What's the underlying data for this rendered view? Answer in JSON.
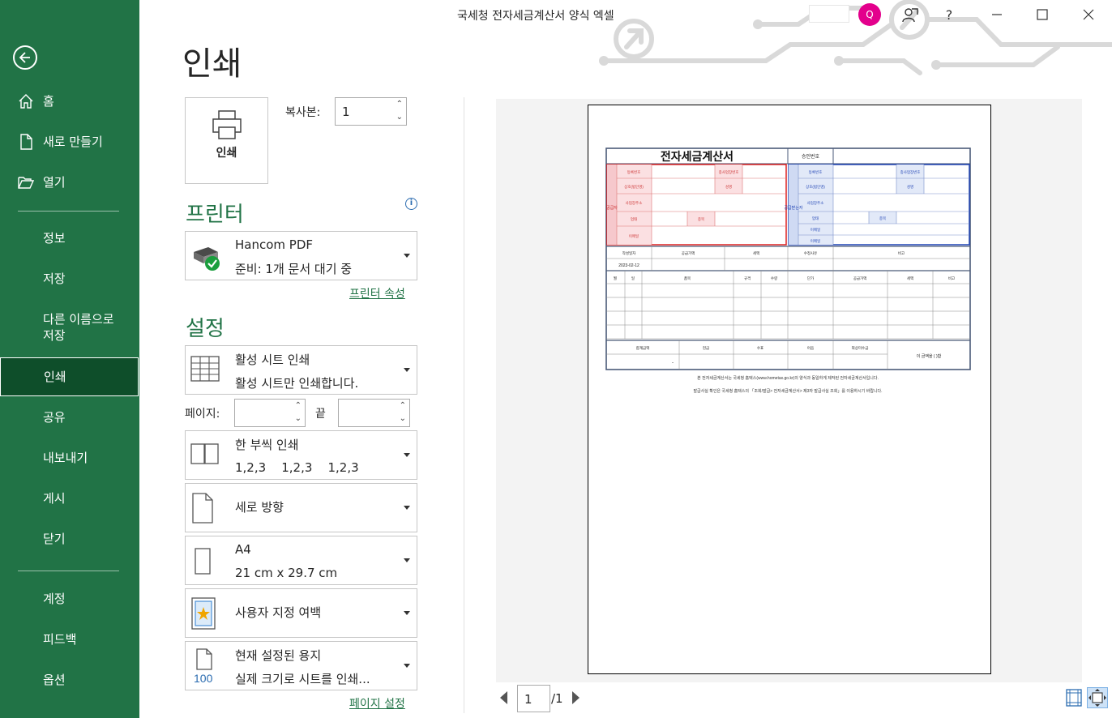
{
  "window": {
    "title": "국세청 전자세금계산서 양식 엑셀",
    "avatar_initial": "Q",
    "help_label": "?"
  },
  "sidebar": {
    "items": [
      {
        "label": "홈",
        "icon": "home-icon"
      },
      {
        "label": "새로 만들기",
        "icon": "new-document-icon"
      },
      {
        "label": "열기",
        "icon": "open-folder-icon"
      },
      {
        "label": "정보"
      },
      {
        "label": "저장"
      },
      {
        "label": "다른 이름으로\n저장"
      },
      {
        "label": "인쇄",
        "active": true
      },
      {
        "label": "공유"
      },
      {
        "label": "내보내기"
      },
      {
        "label": "게시"
      },
      {
        "label": "닫기"
      },
      {
        "label": "계정"
      },
      {
        "label": "피드백"
      },
      {
        "label": "옵션"
      }
    ]
  },
  "main": {
    "title": "인쇄",
    "print_button_label": "인쇄",
    "copies_label": "복사본:",
    "copies_value": "1",
    "printer_section_title": "프린터",
    "printer_name": "Hancom PDF",
    "printer_status": "준비: 1개 문서 대기 중",
    "printer_properties_link": "프린터 속성",
    "settings_section_title": "설정",
    "settings": {
      "what": {
        "line1": "활성 시트 인쇄",
        "line2": "활성 시트만 인쇄합니다."
      },
      "pages_label": "페이지:",
      "pages_to_label": "끝",
      "collate": {
        "line1": "한 부씩 인쇄",
        "line2": "1,2,3    1,2,3    1,2,3"
      },
      "orientation": {
        "line1": "세로 방향"
      },
      "paper": {
        "line1": "A4",
        "line2": "21 cm x 29.7 cm"
      },
      "margins": {
        "line1": "사용자 지정 여백"
      },
      "scaling": {
        "line1": "현재 설정된 용지",
        "line2": "실제 크기로 시트를 인쇄..."
      }
    },
    "page_setup_link": "페이지 설정"
  },
  "preview": {
    "current_page": "1",
    "total_pages": "/1",
    "invoice": {
      "title": "전자세금계산서",
      "approval_no_label": "승인번호",
      "supplier_label": "공급자",
      "buyer_label": "공급받는자",
      "reg_no_label": "등록번호",
      "branch_no_label": "종사업장번호",
      "company_label": "상호(법인명)",
      "name_label": "성명",
      "address_label": "사업장주소",
      "business_label": "업태",
      "item_label": "종목",
      "email_label": "이메일",
      "date_header": "작성일자",
      "supply_amount_header": "공급가액",
      "tax_header": "세액",
      "reason_header": "수정사유",
      "note_header": "비고",
      "date_value": "2023-02-12",
      "item_headers": [
        "월",
        "일",
        "품목",
        "규격",
        "수량",
        "단가",
        "공급가액",
        "세액",
        "비고"
      ],
      "total_headers": [
        "합계금액",
        "현금",
        "수표",
        "어음",
        "외상미수금"
      ],
      "total_dash": "-",
      "claim_text": "이 금액을 (  )함",
      "footer_line1": "본 전자세금계산서는 국세청 홈택스(www.hometax.go.kr)의 양식과 동일하게 제작된 전자세금계산서입니다.",
      "footer_line2": "발급사실 확인은 국세청 홈택스의 「조회/발급> 전자세금계산서> 제3자 발급사실 조회」를 이용하시기 바랍니다."
    }
  }
}
